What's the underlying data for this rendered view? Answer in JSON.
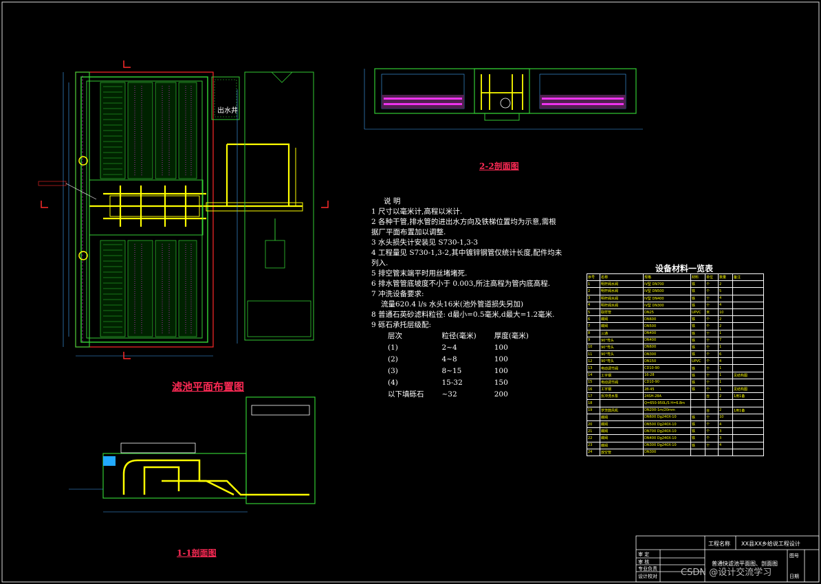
{
  "labels": {
    "out_well": "出水井",
    "plan_title": "滤池平面布置图",
    "section_22_title": "2-2剖面图",
    "section_11_title": "1-1剖面图"
  },
  "notes": {
    "heading": "说 明",
    "items": [
      "1 尺寸以毫米计,高程以米计.",
      "2 各种干管,排水管的进出水方向及铁梯位置均为示意,需根",
      "   据厂平面布置加以调整.",
      "3 水头损失计安装见  S730-1,3-3",
      "4 工程量见  S730-1,3-2,其中镀锌钢管仅统计长度,配件均未",
      "   列入.",
      "5 排空管末端平时用丝堵堵死.",
      "6 排水管管底坡度不小于 0.003,所注高程为管内底高程.",
      "7 冲洗设备要求:",
      "   流量620.4 l/s 水头16米(池外管道损失另加)",
      "8 普通石英砂滤料粒径: d最小=0.5毫米,d最大=1.2毫米.",
      "9 砾石承托层级配:"
    ],
    "layer_header": [
      "层次",
      "粒径(毫米)",
      "厚度(毫米)"
    ],
    "layers": [
      [
        "(1)",
        "2~4",
        "100"
      ],
      [
        "(2)",
        "4~8",
        "100"
      ],
      [
        "(3)",
        "8~15",
        "100"
      ],
      [
        "(4)",
        "15-32",
        "150"
      ],
      [
        "以下填砾石",
        "~32",
        "200"
      ]
    ]
  },
  "equipment": {
    "title": "设备材料一览表",
    "headers": [
      "序号",
      "名称",
      "规格",
      "材料",
      "单位",
      "数量",
      "备注"
    ],
    "rows": [
      [
        "1",
        "明杆阀水阀",
        "IV型 DN700",
        "铁",
        "个",
        "2",
        ""
      ],
      [
        "2",
        "明杆阀水阀",
        "IV型 DN500",
        "铁",
        "个",
        "5",
        ""
      ],
      [
        "3",
        "明杆阀水阀",
        "IV型 DN400",
        "铁",
        "个",
        "4",
        ""
      ],
      [
        "4",
        "明杆阀水阀",
        "IV型 DN300",
        "铁",
        "个",
        "4",
        ""
      ],
      [
        "5",
        "取样管",
        "DN25",
        "UPVC",
        "米",
        "10",
        ""
      ],
      [
        "6",
        "蝶阀",
        "DN600",
        "铁",
        "个",
        "2",
        ""
      ],
      [
        "7",
        "蝶阀",
        "DN500",
        "铁",
        "个",
        "2",
        ""
      ],
      [
        "8",
        "三通",
        "DN400",
        "铁",
        "个",
        "1",
        ""
      ],
      [
        "9",
        "90°弯头",
        "DN400",
        "铁",
        "个",
        "7",
        ""
      ],
      [
        "10",
        "90°弯头",
        "DN600",
        "铁",
        "个",
        "1",
        ""
      ],
      [
        "11",
        "90°弯头",
        "DN300",
        "铁",
        "个",
        "6",
        ""
      ],
      [
        "12",
        "90°弯头",
        "DN150",
        "UPVC",
        "个",
        "4",
        ""
      ],
      [
        "13",
        "电动调节阀",
        "CD10-90",
        "铁",
        "个",
        "1",
        ""
      ],
      [
        "14",
        "工字钢",
        "16-28",
        "铁",
        "个",
        "1",
        "见结构图"
      ],
      [
        "15",
        "电动调节阀",
        "CD10-90",
        "铁",
        "个",
        "1",
        ""
      ],
      [
        "16",
        "工字钢",
        "28-45",
        "铁",
        "个",
        "1",
        "见结构图"
      ],
      [
        "17",
        "反冲洗水泵",
        "24SH-28A",
        "",
        "台",
        "2",
        "1用1备"
      ],
      [
        "18",
        "",
        "Q=650-950L/S H=6.8m",
        "",
        "",
        "",
        ""
      ],
      [
        "19",
        "罗茨鼓风机",
        "DN200-1m/20mm",
        "",
        "台",
        "2",
        "1用1备"
      ],
      [
        "",
        "蝶阀",
        "DN600 Dg240X-10",
        "铁",
        "个",
        "10",
        ""
      ],
      [
        "20",
        "蝶阀",
        "DN500 Dg240X-10",
        "铁",
        "个",
        "4",
        ""
      ],
      [
        "21",
        "蝶阀",
        "DN700 Dg240X-10",
        "铁",
        "个",
        "3",
        ""
      ],
      [
        "22",
        "蝶阀",
        "DN400 Dg240X-10",
        "铁",
        "个",
        "3",
        ""
      ],
      [
        "23",
        "蝶阀",
        "DN300 Dg240X-10",
        "铁",
        "个",
        "4",
        ""
      ],
      [
        "24",
        "放空管",
        "DN300",
        "",
        "",
        "",
        ""
      ]
    ]
  },
  "title_block": {
    "project_label": "工程名称",
    "project_name": "XX县XX乡给说工程设计",
    "drawing_name": "普通快滤池平面图、剖面图",
    "row_labels": [
      "审  定",
      "审  核",
      "专业负责",
      "设计校对"
    ],
    "right_labels": [
      "图号",
      "日期"
    ]
  },
  "watermark": "CSDN @设计交流学习"
}
